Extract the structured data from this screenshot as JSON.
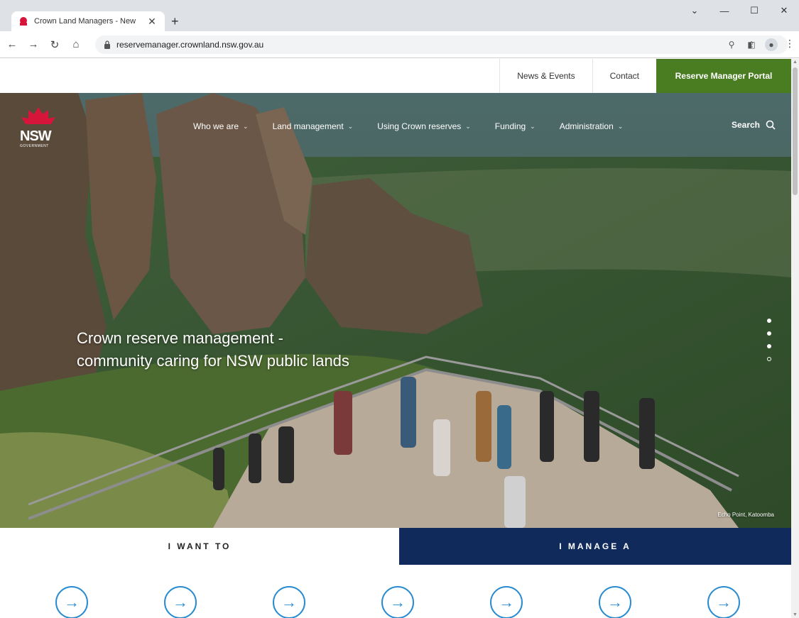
{
  "browser": {
    "tab_title": "Crown Land Managers - New",
    "url": "reservemanager.crownland.nsw.gov.au"
  },
  "utility_nav": {
    "news": "News & Events",
    "contact": "Contact",
    "portal": "Reserve Manager Portal"
  },
  "logo": {
    "text": "NSW",
    "sub": "GOVERNMENT"
  },
  "main_nav": [
    {
      "label": "Who we are"
    },
    {
      "label": "Land management"
    },
    {
      "label": "Using Crown reserves"
    },
    {
      "label": "Funding"
    },
    {
      "label": "Administration"
    }
  ],
  "search_label": "Search",
  "hero": {
    "line1": "Crown reserve management -",
    "line2": "community caring for NSW public lands",
    "caption": "Echo Point, Katoomba",
    "slides_total": 4,
    "active_slide": 4
  },
  "tabs": {
    "want": "I WANT TO",
    "manage": "I MANAGE A"
  },
  "colors": {
    "portal_green": "#4a7c22",
    "navy": "#102a5c",
    "link_blue": "#2a8cd0"
  }
}
